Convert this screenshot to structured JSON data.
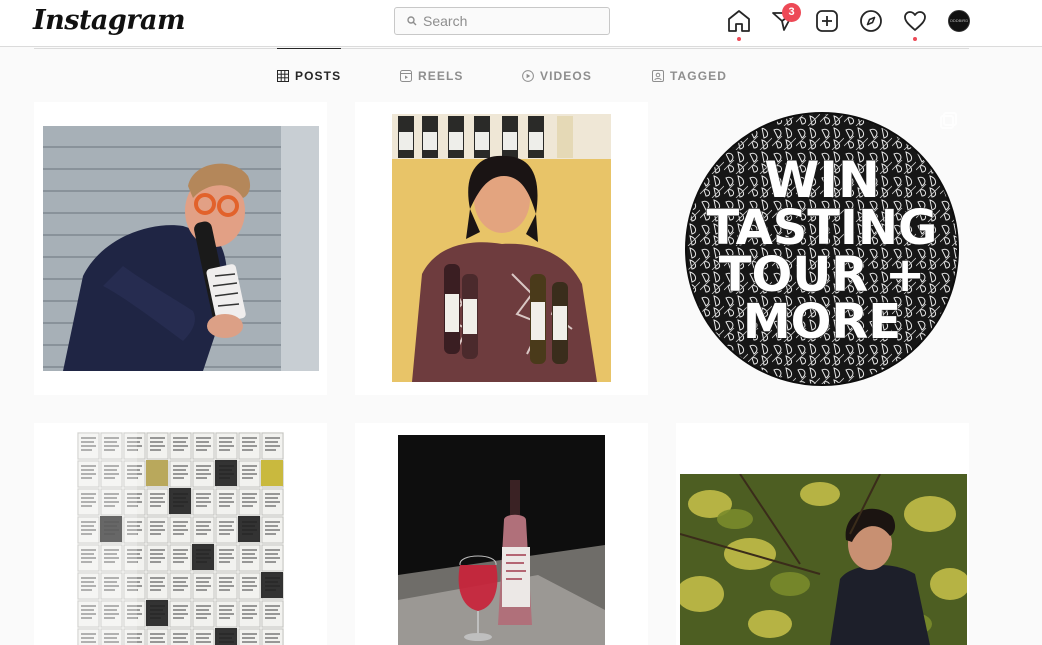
{
  "header": {
    "logo_text": "Instagram",
    "search_placeholder": "Search",
    "direct_badge_count": "3",
    "avatar_text": "ODDBIRD"
  },
  "tabs": [
    {
      "label": "POSTS",
      "icon": "grid-icon",
      "active": true
    },
    {
      "label": "REELS",
      "icon": "reels-icon",
      "active": false
    },
    {
      "label": "VIDEOS",
      "icon": "play-icon",
      "active": false
    },
    {
      "label": "TAGGED",
      "icon": "tagged-icon",
      "active": false
    }
  ],
  "posts": [
    {
      "description": "man biting wine bottle"
    },
    {
      "description": "woman holding wine bottles"
    },
    {
      "headline": [
        "WIN",
        "TASTING",
        "TOUR +",
        "MORE"
      ]
    },
    {
      "description": "wall of wine labels"
    },
    {
      "description": "rosé bottle and glass"
    },
    {
      "description": "man in vineyard"
    }
  ],
  "colors": {
    "accent_red": "#ed4956",
    "text_dark": "#262626",
    "text_muted": "#8e8e8e",
    "border": "#dbdbdb"
  }
}
